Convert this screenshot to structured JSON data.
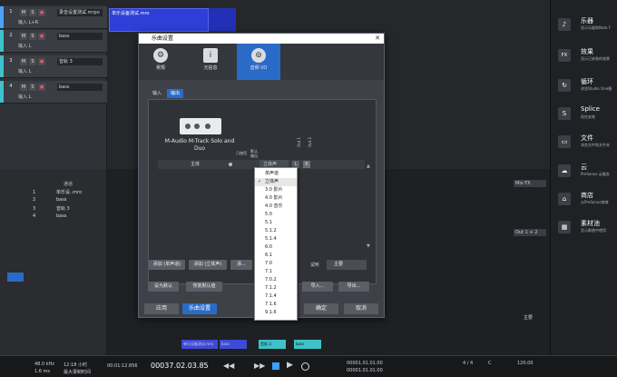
{
  "tracks": [
    {
      "num": "1",
      "name": "录音设置测试.mrpo",
      "sub": "输入 L+R",
      "color": "#4aa3ff"
    },
    {
      "num": "2",
      "name": "bass",
      "sub": "输入 L",
      "color": "#3ec1c9"
    },
    {
      "num": "3",
      "name": "音轨 3",
      "sub": "输入 L",
      "color": "#3ec1c9"
    },
    {
      "num": "4",
      "name": "bass",
      "sub": "输入 L",
      "color": "#3ec1c9"
    }
  ],
  "track_buttons": [
    "M",
    "S",
    "●"
  ],
  "clip": {
    "name": "单乐设备测试.mro"
  },
  "console": {
    "header_col1": "通道",
    "header_col2": "乐器",
    "rows": [
      {
        "num": "1",
        "name": "单乐设..mro"
      },
      {
        "num": "2",
        "name": "bass"
      },
      {
        "num": "3",
        "name": "音轨 3"
      },
      {
        "num": "4",
        "name": "bass"
      }
    ]
  },
  "mixer": {
    "bus_label": "Mix FX",
    "out_label": "Out 1 + 2",
    "main_label": "主要",
    "channel_names": [
      "单乐设备测试.mro",
      "bass",
      "音轨 3",
      "bass"
    ]
  },
  "browser": {
    "items": [
      {
        "icon": "♪",
        "title": "乐器",
        "desc": "显示乐器和Note F"
      },
      {
        "icon": "FX",
        "title": "效果",
        "desc": "显示已安装的效果"
      },
      {
        "icon": "↻",
        "title": "循环",
        "desc": "浏览Studio One循"
      },
      {
        "icon": "S",
        "title": "Splice",
        "desc": "现在安装"
      },
      {
        "icon": "▭",
        "title": "文件",
        "desc": "浏览文件和文件夹"
      },
      {
        "icon": "☁",
        "title": "云",
        "desc": "PreSonus 云服务"
      },
      {
        "icon": "⌂",
        "title": "商店",
        "desc": "从PreSonus商城"
      },
      {
        "icon": "▦",
        "title": "素材池",
        "desc": "显示歌曲中使用"
      }
    ]
  },
  "dialog": {
    "title": "乐曲设置",
    "tabs": [
      {
        "label": "常规",
        "icon": "⚙"
      },
      {
        "label": "元信息",
        "icon": "i"
      },
      {
        "label": "音频 I/O",
        "icon": "⊚"
      }
    ],
    "subtabs": [
      "输入",
      "输出"
    ],
    "device_name": "M-Audio M-Track Solo and Duo",
    "col_headers": [
      "已使用",
      "默认 输出"
    ],
    "out_cols": [
      "Out 1",
      "Out 2"
    ],
    "row": {
      "name": "主体",
      "format": "立体声",
      "l": "L",
      "r": "R"
    },
    "buttons_row1": [
      "添加 (单声道)",
      "添加 (立体声)",
      "添..."
    ],
    "monitor_label": "试听",
    "monitor_value": "主要",
    "buttons_row2": [
      "设为默认",
      "恢复默认值",
      "导入...",
      "导出..."
    ],
    "footer": {
      "apply": "应用",
      "song_setup": "乐曲设置",
      "ok": "确定",
      "cancel": "取消"
    }
  },
  "dropdown": {
    "items": [
      "单声道",
      "立体声",
      "3.0 影片",
      "4.0 影片",
      "4.0 音乐",
      "5.0",
      "5.1",
      "5.1.2",
      "5.1.4",
      "6.0",
      "6.1",
      "7.0",
      "7.1",
      "7.0.2",
      "7.1.2",
      "7.1.4",
      "7.1.6",
      "9.1.6"
    ],
    "selected_index": 1
  },
  "transport": {
    "sample_rate": "48.0 kHz",
    "latency": "1.6 ms",
    "record_time": "12:18 小时",
    "record_label": "最大录制时间",
    "position": "00:01:12.856",
    "bars": "00037.02.03.85",
    "loop_start": "00001.01.01.00",
    "loop_end": "00001.01.01.00",
    "time_sig": "4 / 4",
    "tempo": "120.00",
    "key": "C"
  }
}
